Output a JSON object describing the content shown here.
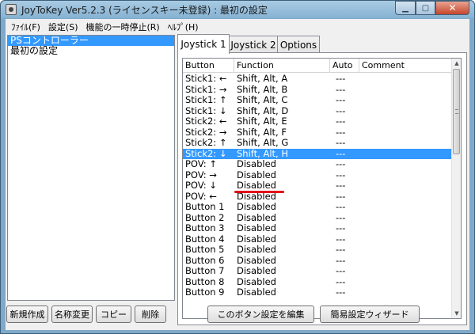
{
  "window": {
    "title": "JoyToKey Ver5.2.3 (ライセンスキー未登録) : 最初の設定",
    "caption_buttons": {
      "minimize_icon": "minimize-icon",
      "maximize_icon": "maximize-icon",
      "close_icon": "close-icon"
    }
  },
  "menubar": {
    "items": [
      "ﾌｧｲﾙ(F)",
      "設定(S)",
      "機能の一時停止(R)",
      "ﾍﾙﾌﾟ(H)"
    ]
  },
  "profiles": {
    "items": [
      "PSコントローラー",
      "最初の設定"
    ],
    "selected_index": 0
  },
  "profile_buttons": {
    "new": "新規作成",
    "rename": "名称変更",
    "copy": "コピー",
    "delete": "削除"
  },
  "tabs": [
    "Joystick 1",
    "Joystick 2",
    "Options"
  ],
  "grid": {
    "columns": [
      "Button",
      "Function",
      "Auto",
      "Comment"
    ],
    "rows": [
      {
        "button": "Stick1: ←",
        "function": "Shift, Alt, A",
        "auto": "---",
        "comment": ""
      },
      {
        "button": "Stick1: →",
        "function": "Shift, Alt, B",
        "auto": "---",
        "comment": ""
      },
      {
        "button": "Stick1: ↑",
        "function": "Shift, Alt, C",
        "auto": "---",
        "comment": ""
      },
      {
        "button": "Stick1: ↓",
        "function": "Shift, Alt, D",
        "auto": "---",
        "comment": ""
      },
      {
        "button": "Stick2: ←",
        "function": "Shift, Alt, E",
        "auto": "---",
        "comment": ""
      },
      {
        "button": "Stick2: →",
        "function": "Shift, Alt, F",
        "auto": "---",
        "comment": ""
      },
      {
        "button": "Stick2: ↑",
        "function": "Shift, Alt, G",
        "auto": "---",
        "comment": ""
      },
      {
        "button": "Stick2: ↓",
        "function": "Shift, Alt, H",
        "auto": "---",
        "comment": ""
      },
      {
        "button": "POV: ↑",
        "function": "Disabled",
        "auto": "---",
        "comment": ""
      },
      {
        "button": "POV: →",
        "function": "Disabled",
        "auto": "---",
        "comment": ""
      },
      {
        "button": "POV: ↓",
        "function": "Disabled",
        "auto": "---",
        "comment": ""
      },
      {
        "button": "POV: ←",
        "function": "Disabled",
        "auto": "---",
        "comment": ""
      },
      {
        "button": "Button 1",
        "function": "Disabled",
        "auto": "---",
        "comment": ""
      },
      {
        "button": "Button 2",
        "function": "Disabled",
        "auto": "---",
        "comment": ""
      },
      {
        "button": "Button 3",
        "function": "Disabled",
        "auto": "---",
        "comment": ""
      },
      {
        "button": "Button 4",
        "function": "Disabled",
        "auto": "---",
        "comment": ""
      },
      {
        "button": "Button 5",
        "function": "Disabled",
        "auto": "---",
        "comment": ""
      },
      {
        "button": "Button 6",
        "function": "Disabled",
        "auto": "---",
        "comment": ""
      },
      {
        "button": "Button 7",
        "function": "Disabled",
        "auto": "---",
        "comment": ""
      },
      {
        "button": "Button 8",
        "function": "Disabled",
        "auto": "---",
        "comment": ""
      },
      {
        "button": "Button 9",
        "function": "Disabled",
        "auto": "---",
        "comment": ""
      }
    ],
    "selected_index": 7
  },
  "panel_buttons": {
    "edit": "このボタン設定を編集",
    "wizard": "簡易設定ウィザード"
  },
  "colors": {
    "selection": "#3399ff",
    "annotation_underline": "#e0001a",
    "title_bar": "#86b2d2"
  }
}
